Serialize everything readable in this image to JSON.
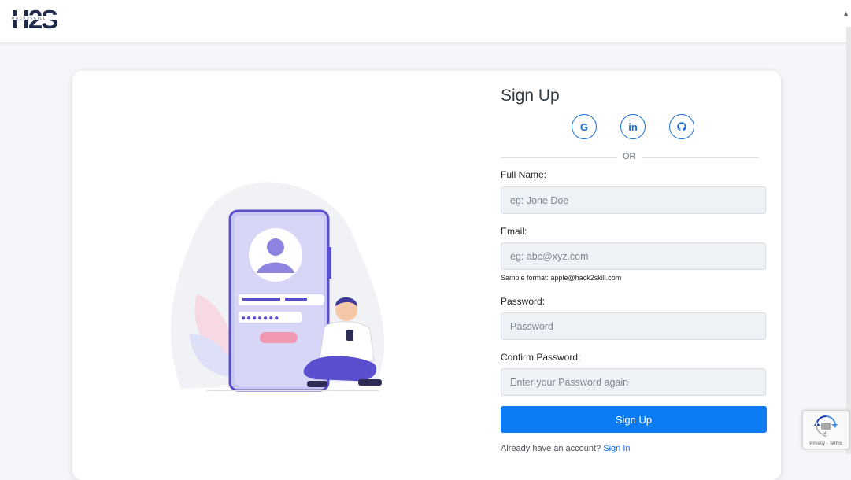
{
  "header": {
    "logo_text": "H2S",
    "logo_subtext": "HACK2SKILL"
  },
  "form": {
    "title": "Sign Up",
    "social": [
      {
        "name": "google",
        "glyph": "G"
      },
      {
        "name": "linkedin",
        "glyph": "in"
      },
      {
        "name": "github",
        "glyph": "github-icon"
      }
    ],
    "or_text": "OR",
    "full_name": {
      "label": "Full Name:",
      "placeholder": "eg: Jone Doe",
      "value": ""
    },
    "email": {
      "label": "Email:",
      "placeholder": "eg: abc@xyz.com",
      "value": "",
      "hint": "Sample format: apple@hack2skill.com"
    },
    "password": {
      "label": "Password:",
      "placeholder": "Password",
      "value": ""
    },
    "confirm_password": {
      "label": "Confirm Password:",
      "placeholder": "Enter your Password again",
      "value": ""
    },
    "submit_label": "Sign Up",
    "signin_prompt": "Already have an account?",
    "signin_link": "Sign In"
  },
  "recaptcha": {
    "text": "Privacy - Terms"
  },
  "colors": {
    "primary": "#0d7cf2",
    "social": "#1c6fd1",
    "illustration_purple": "#5a4fcf"
  }
}
